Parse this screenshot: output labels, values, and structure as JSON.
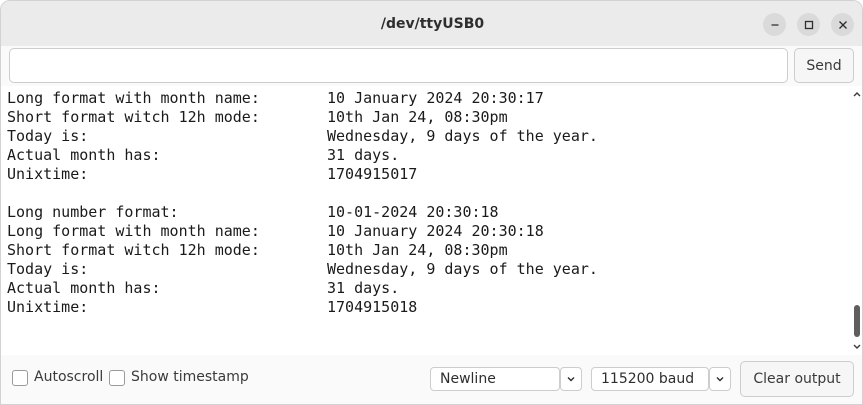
{
  "window": {
    "title": "/dev/ttyUSB0",
    "controls": [
      "minimize-icon",
      "maximize-icon",
      "close-icon"
    ]
  },
  "input": {
    "value": "",
    "placeholder": "",
    "send_label": "Send"
  },
  "output": {
    "lines": [
      {
        "label": "Long format with month name:",
        "value": "10 January 2024 20:30:17"
      },
      {
        "label": "Short format witch 12h mode:",
        "value": "10th Jan 24, 08:30pm"
      },
      {
        "label": "Today is:",
        "value": "Wednesday, 9 days of the year."
      },
      {
        "label": "Actual month has:",
        "value": "31 days."
      },
      {
        "label": "Unixtime:",
        "value": "1704915017"
      },
      {
        "label": "",
        "value": ""
      },
      {
        "label": "Long number format:",
        "value": "10-01-2024 20:30:18"
      },
      {
        "label": "Long format with month name:",
        "value": "10 January 2024 20:30:18"
      },
      {
        "label": "Short format witch 12h mode:",
        "value": "10th Jan 24, 08:30pm"
      },
      {
        "label": "Today is:",
        "value": "Wednesday, 9 days of the year."
      },
      {
        "label": "Actual month has:",
        "value": "31 days."
      },
      {
        "label": "Unixtime:",
        "value": "1704915018"
      }
    ]
  },
  "bottom": {
    "autoscroll_label": "Autoscroll",
    "autoscroll_checked": false,
    "timestamp_label": "Show timestamp",
    "timestamp_checked": false,
    "line_ending": "Newline",
    "baud": "115200 baud",
    "clear_label": "Clear output"
  }
}
